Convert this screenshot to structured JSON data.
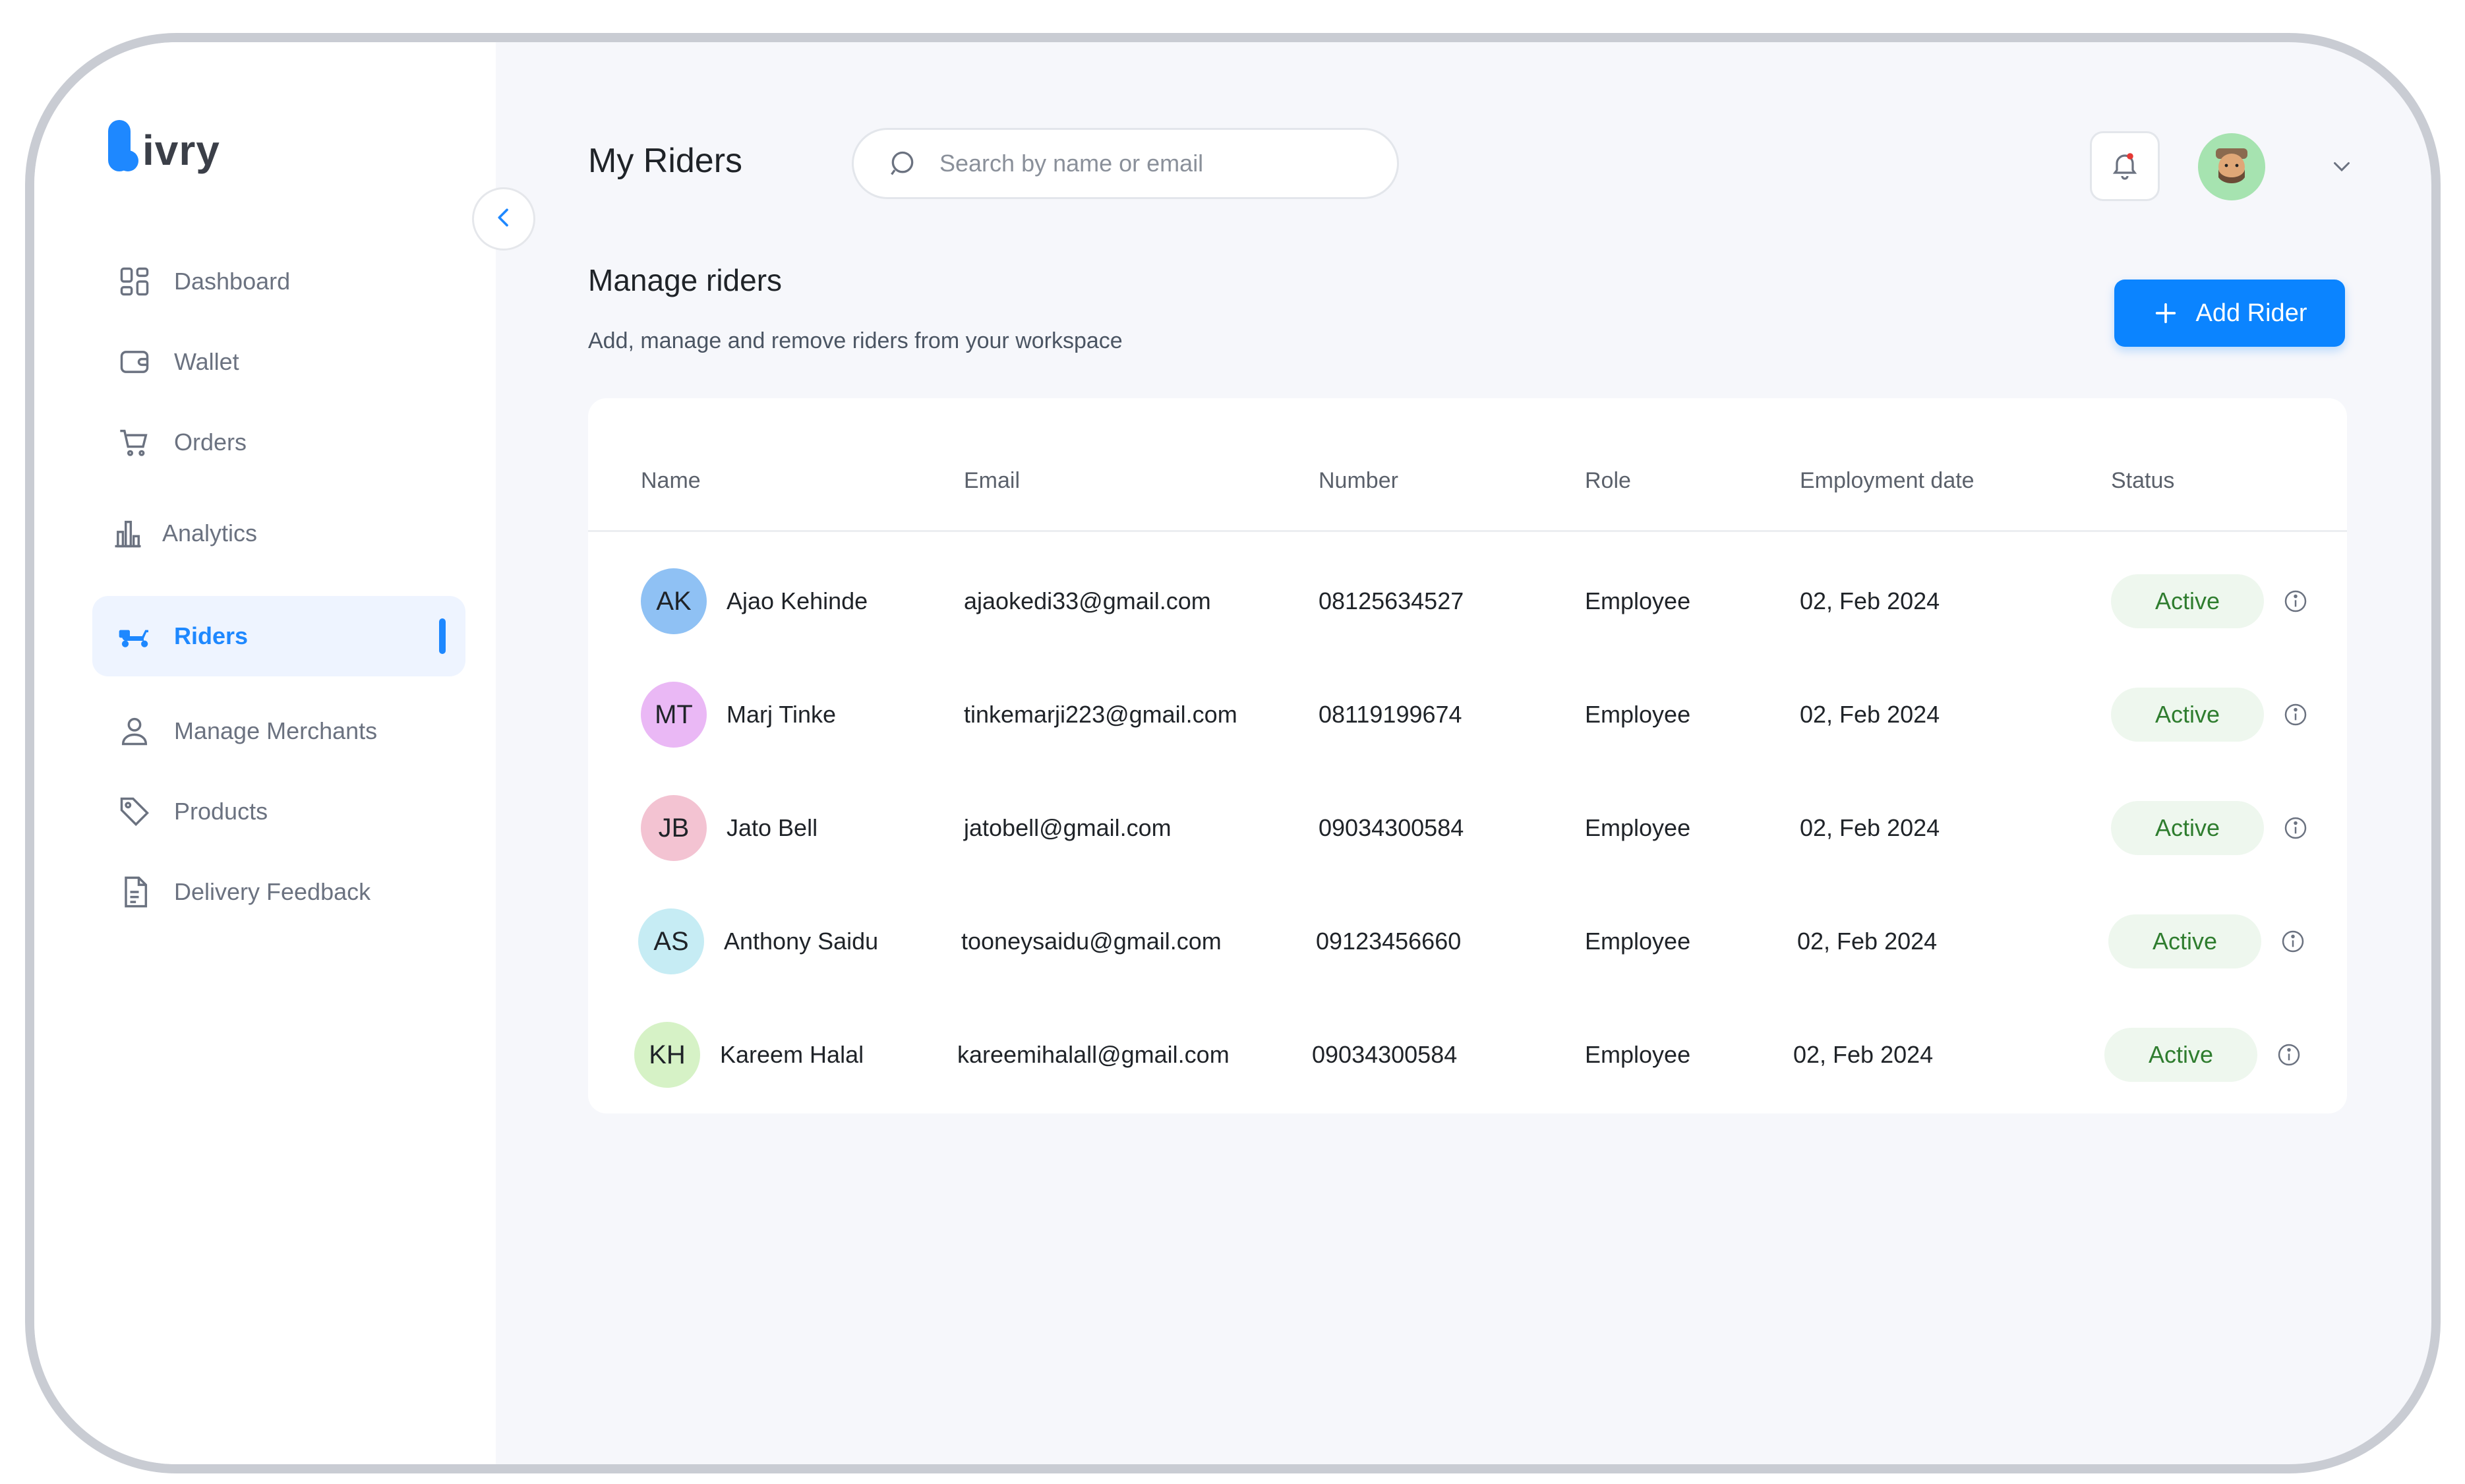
{
  "brand": {
    "logo_text": "ivry"
  },
  "sidebar": {
    "items": [
      {
        "label": "Dashboard",
        "icon": "dashboard-grid-icon"
      },
      {
        "label": "Wallet",
        "icon": "wallet-icon"
      },
      {
        "label": "Orders",
        "icon": "cart-icon"
      },
      {
        "label": "Analytics",
        "icon": "bar-chart-icon"
      },
      {
        "label": "Riders",
        "icon": "scooter-icon",
        "active": true
      },
      {
        "label": "Manage Merchants",
        "icon": "user-icon"
      },
      {
        "label": "Products",
        "icon": "tag-icon"
      },
      {
        "label": "Delivery Feedback",
        "icon": "document-icon"
      }
    ]
  },
  "header": {
    "title": "My Riders",
    "search_placeholder": "Search by name or email"
  },
  "section": {
    "title": "Manage riders",
    "subtitle": "Add, manage and remove riders from your workspace",
    "add_button": "Add Rider"
  },
  "table": {
    "columns": [
      "Name",
      "Email",
      "Number",
      "Role",
      "Employment date",
      "Status"
    ],
    "rows": [
      {
        "initials": "AK",
        "name": "Ajao Kehinde",
        "email": "ajaokedi33@gmail.com",
        "number": "08125634527",
        "role": "Employee",
        "date": "02, Feb 2024",
        "status": "Active",
        "avatar_color": "#8fc1f4"
      },
      {
        "initials": "MT",
        "name": "Marj Tinke",
        "email": "tinkemarji223@gmail.com",
        "number": "08119199674",
        "role": "Employee",
        "date": "02, Feb 2024",
        "status": "Active",
        "avatar_color": "#eab8f5"
      },
      {
        "initials": "JB",
        "name": "Jato Bell",
        "email": "jatobell@gmail.com",
        "number": "09034300584",
        "role": "Employee",
        "date": "02, Feb 2024",
        "status": "Active",
        "avatar_color": "#f3c3d2"
      },
      {
        "initials": "AS",
        "name": "Anthony Saidu",
        "email": "tooneysaidu@gmail.com",
        "number": "09123456660",
        "role": "Employee",
        "date": "02, Feb 2024",
        "status": "Active",
        "avatar_color": "#c6ecf4"
      },
      {
        "initials": "KH",
        "name": "Kareem Halal",
        "email": "kareemihalall@gmail.com",
        "number": "09034300584",
        "role": "Employee",
        "date": "02, Feb 2024",
        "status": "Active",
        "avatar_color": "#d6f2c6"
      }
    ]
  },
  "colors": {
    "accent": "#0b84ff",
    "active_badge_bg": "#eef7ee",
    "active_badge_text": "#2f7d2f",
    "user_avatar_bg": "#a6e3b0"
  }
}
